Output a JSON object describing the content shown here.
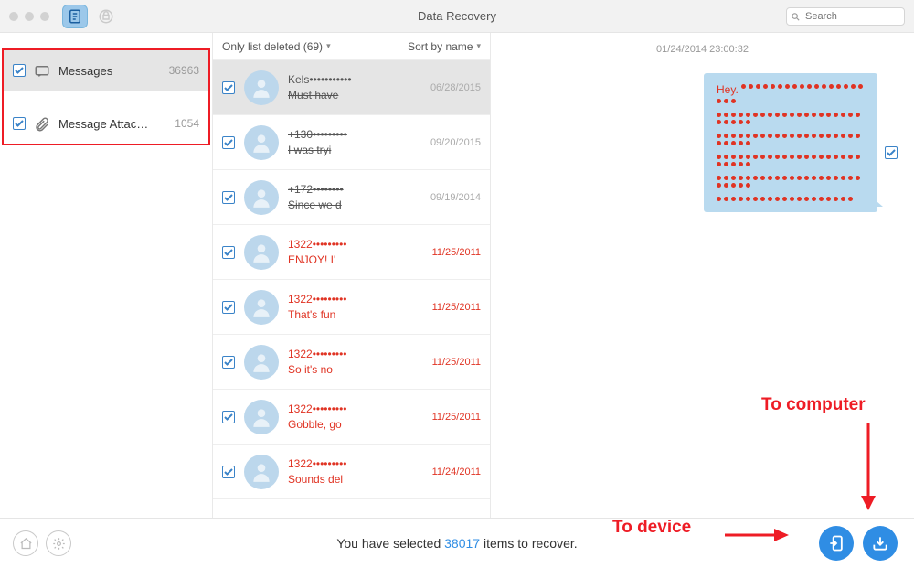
{
  "header": {
    "title": "Data Recovery",
    "search_placeholder": "Search"
  },
  "sidebar": {
    "items": [
      {
        "label": "Messages",
        "count": "36963",
        "selected": true
      },
      {
        "label": "Message Attac…",
        "count": "1054",
        "selected": false
      }
    ]
  },
  "mid": {
    "filter_label": "Only list deleted (69)",
    "sort_label": "Sort by name",
    "conversations": [
      {
        "name": "Kels•••••••••••",
        "preview": "Must have",
        "date": "06/28/2015",
        "style": "deleted",
        "selected": true
      },
      {
        "name": "+130•••••••••",
        "preview": "I was tryi",
        "date": "09/20/2015",
        "style": "deleted",
        "selected": false
      },
      {
        "name": "+172••••••••",
        "preview": "Since we d",
        "date": "09/19/2014",
        "style": "deleted",
        "selected": false
      },
      {
        "name": "1322•••••••••",
        "preview": "ENJOY!  I'",
        "date": "11/25/2011",
        "style": "recov",
        "selected": false
      },
      {
        "name": "1322•••••••••",
        "preview": "That's fun",
        "date": "11/25/2011",
        "style": "recov",
        "selected": false
      },
      {
        "name": "1322•••••••••",
        "preview": "So it's no",
        "date": "11/25/2011",
        "style": "recov",
        "selected": false
      },
      {
        "name": "1322•••••••••",
        "preview": "Gobble, go",
        "date": "11/25/2011",
        "style": "recov",
        "selected": false
      },
      {
        "name": "1322•••••••••",
        "preview": "Sounds del",
        "date": "11/24/2011",
        "style": "recov",
        "selected": false
      }
    ]
  },
  "detail": {
    "timestamp": "01/24/2014 23:00:32",
    "bubble_intro": "Hey.",
    "bubble_dot_rows": [
      20,
      25,
      25,
      25,
      25,
      19
    ]
  },
  "bottom": {
    "text_pre": "You have selected ",
    "count": "38017",
    "text_post": " items to recover."
  },
  "annotations": {
    "to_device": "To device",
    "to_computer": "To computer"
  }
}
